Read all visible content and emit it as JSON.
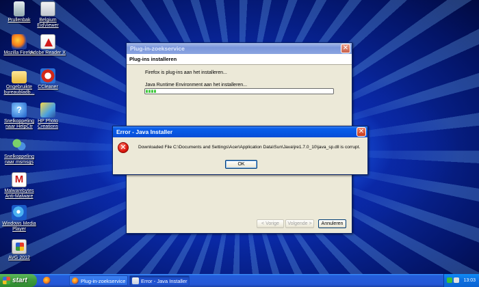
{
  "desktop": {
    "icons": [
      {
        "label": "Prullenbak",
        "icon": "recycle-bin-icon"
      },
      {
        "label": "Belgium EidViewer",
        "icon": "eid-viewer-icon"
      },
      {
        "label": "Mozilla Firefox",
        "icon": "firefox-icon"
      },
      {
        "label": "Adobe Reader X",
        "icon": "adobe-reader-icon"
      },
      {
        "label": "Ongebruikte bureaubladb...",
        "icon": "folder-icon"
      },
      {
        "label": "CCleaner",
        "icon": "ccleaner-icon"
      },
      {
        "label": "Snelkoppeling naar HelpCtr",
        "icon": "help-center-icon"
      },
      {
        "label": "HP Photo Creations",
        "icon": "hp-photo-icon"
      },
      {
        "label": "Snelkoppeling naar msmsgs",
        "icon": "messenger-icon"
      },
      {
        "label": "Malwarebytes Anti-Malware",
        "icon": "malwarebytes-icon"
      },
      {
        "label": "Windows Media Player",
        "icon": "media-player-icon"
      },
      {
        "label": "AVG 2012",
        "icon": "avg-icon"
      }
    ]
  },
  "plugin_window": {
    "title": "Plug-in-zoekservice",
    "header": "Plug-ins installeren",
    "status_text": "Firefox is plug-ins aan het installeren...",
    "progress_label": "Java Runtime Environment aan het installeren...",
    "progress": 0.06,
    "back_label": "< Vorige",
    "next_label": "Volgende >",
    "cancel_label": "Annuleren"
  },
  "error_dialog": {
    "title": "Error - Java Installer",
    "message": "Downloaded File C:\\Documents and Settings\\Acer\\Application Data\\Sun\\Java\\jre1.7.0_10\\java_sp.dll is corrupt.",
    "ok_label": "OK"
  },
  "taskbar": {
    "start_label": "start",
    "tasks": [
      {
        "label": "Plug-in-zoekservice",
        "icon": "firefox-icon"
      },
      {
        "label": "Error - Java Installer",
        "icon": "java-icon"
      }
    ],
    "clock": "13:03"
  },
  "colors": {
    "titlebar_active": "#0a5ce8",
    "titlebar_inactive": "#7a96dc",
    "window_bg": "#ece9d8",
    "taskbar": "#245edb",
    "start_green": "#3c9a3c"
  }
}
